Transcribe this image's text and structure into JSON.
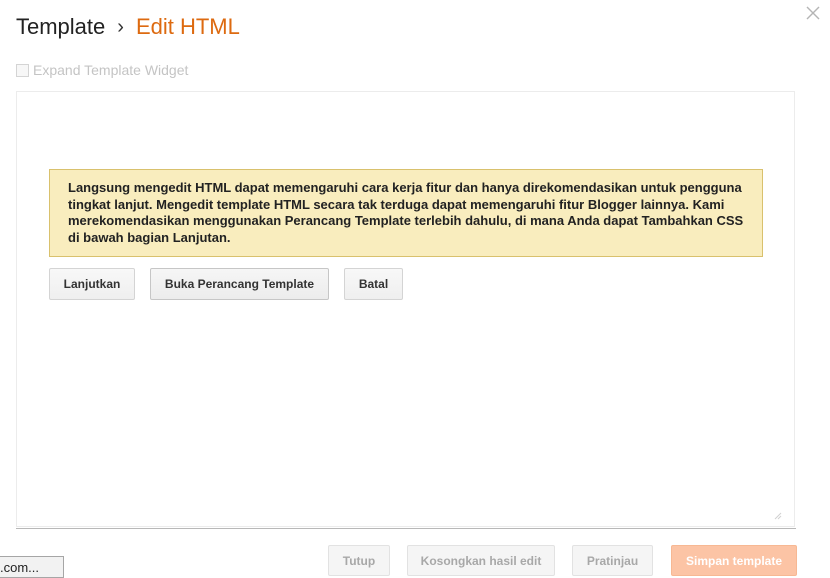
{
  "header": {
    "breadcrumb_parent": "Template",
    "breadcrumb_separator": "›",
    "breadcrumb_current": "Edit HTML",
    "close_icon": "close-icon"
  },
  "options": {
    "expand_label": "Expand Template Widget",
    "expand_checked": false
  },
  "warning": {
    "text": "Langsung mengedit HTML dapat memengaruhi cara kerja fitur dan hanya direkomendasikan untuk pengguna tingkat lanjut. Mengedit template HTML secara tak terduga dapat memengaruhi fitur Blogger lainnya. Kami merekomendasikan menggunakan Perancang Template terlebih dahulu, di mana Anda dapat Tambahkan CSS di bawah bagian Lanjutan."
  },
  "actions": {
    "continue_label": "Lanjutkan",
    "open_designer_label": "Buka Perancang Template",
    "cancel_label": "Batal"
  },
  "footer": {
    "close_label": "Tutup",
    "clear_label": "Kosongkan hasil edit",
    "preview_label": "Pratinjau",
    "save_label": "Simpan template"
  },
  "status_bar": {
    "text": ".com..."
  },
  "colors": {
    "accent": "#dd6a10",
    "warning_bg": "#f9edbe",
    "warning_border": "#d9c16d",
    "save_button_bg": "#fcc4a5"
  }
}
